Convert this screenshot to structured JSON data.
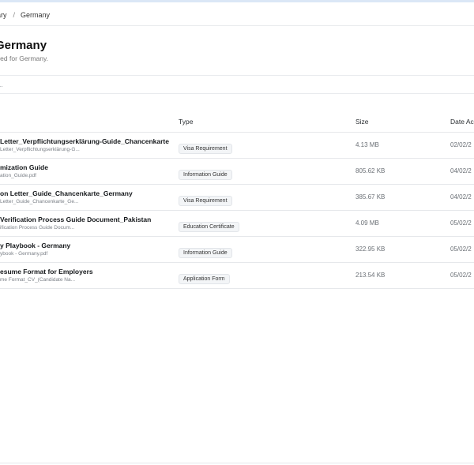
{
  "breadcrumb": {
    "items": [
      "orary",
      "Germany"
    ],
    "separator": "/"
  },
  "header": {
    "title": "Germany",
    "subtitle": "quired for Germany."
  },
  "search": {
    "placeholder": "ts..."
  },
  "table": {
    "columns": {
      "type": "Type",
      "size": "Size",
      "date": "Date Ac"
    },
    "rows": [
      {
        "title": "Letter_Verpflichtungserklärung-Guide_Chancenkarte",
        "file": "Letter_Verpflichtungserklärung-G...",
        "type": "Visa Requirement",
        "size": "4.13 MB",
        "date": "02/02/2"
      },
      {
        "title": "mization Guide",
        "file": "ation_Guide.pdf",
        "type": "Information Guide",
        "size": "805.62 KB",
        "date": "04/02/2"
      },
      {
        "title": "on Letter_Guide_Chancenkarte_Germany",
        "file": "Letter_Guide_Chancenkarte_Ge...",
        "type": "Visa Requirement",
        "size": "385.67 KB",
        "date": "04/02/2"
      },
      {
        "title": "Verification Process Guide Document_Pakistan",
        "file": "ification Process Guide Docum...",
        "type": "Education Certificate",
        "size": "4.09 MB",
        "date": "05/02/2"
      },
      {
        "title": "y Playbook - Germany",
        "file": "ybook - Germany.pdf",
        "type": "Information Guide",
        "size": "322.95 KB",
        "date": "05/02/2"
      },
      {
        "title": "esume Format for Employers",
        "file": "me Format_CV_(Candidate Na...",
        "type": "Application Form",
        "size": "213.54 KB",
        "date": "05/02/2"
      }
    ]
  },
  "colors": {
    "accent_bar": "#dbe7f6",
    "divider": "#e6e8eb",
    "badge_bg": "#f3f5f7"
  }
}
